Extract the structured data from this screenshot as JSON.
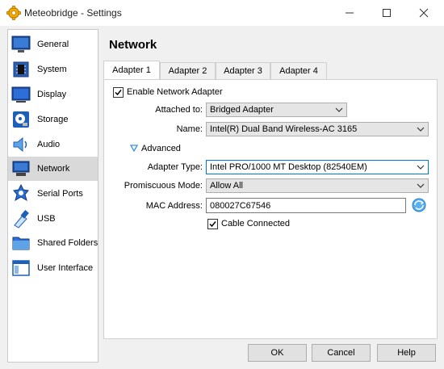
{
  "window": {
    "title": "Meteobridge - Settings",
    "app_icon": "gear-icon"
  },
  "sidebar": {
    "items": [
      {
        "label": "General",
        "icon": "monitor-icon"
      },
      {
        "label": "System",
        "icon": "chip-icon"
      },
      {
        "label": "Display",
        "icon": "display-icon"
      },
      {
        "label": "Storage",
        "icon": "disk-icon"
      },
      {
        "label": "Audio",
        "icon": "speaker-icon"
      },
      {
        "label": "Network",
        "icon": "network-icon"
      },
      {
        "label": "Serial Ports",
        "icon": "serial-port-icon"
      },
      {
        "label": "USB",
        "icon": "usb-icon"
      },
      {
        "label": "Shared Folders",
        "icon": "folder-icon"
      },
      {
        "label": "User Interface",
        "icon": "window-icon"
      }
    ],
    "selected": "Network"
  },
  "page": {
    "title": "Network"
  },
  "tabs": [
    "Adapter 1",
    "Adapter 2",
    "Adapter 3",
    "Adapter 4"
  ],
  "active_tab": "Adapter 1",
  "adapter": {
    "enable_label": "Enable Network Adapter",
    "enable_checked": true,
    "attached_label": "Attached to:",
    "attached_value": "Bridged Adapter",
    "name_label": "Name:",
    "name_value": "Intel(R) Dual Band Wireless-AC 3165",
    "advanced_label": "Advanced",
    "adapter_type_label": "Adapter Type:",
    "adapter_type_value": "Intel PRO/1000 MT Desktop (82540EM)",
    "promiscuous_label": "Promiscuous Mode:",
    "promiscuous_value": "Allow All",
    "mac_label": "MAC Address:",
    "mac_value": "080027C67546",
    "cable_label": "Cable Connected",
    "cable_checked": true
  },
  "buttons": {
    "ok": "OK",
    "cancel": "Cancel",
    "help": "Help"
  },
  "colors": {
    "accent": "#0078d7",
    "selected_bg": "#d9d9d9"
  }
}
